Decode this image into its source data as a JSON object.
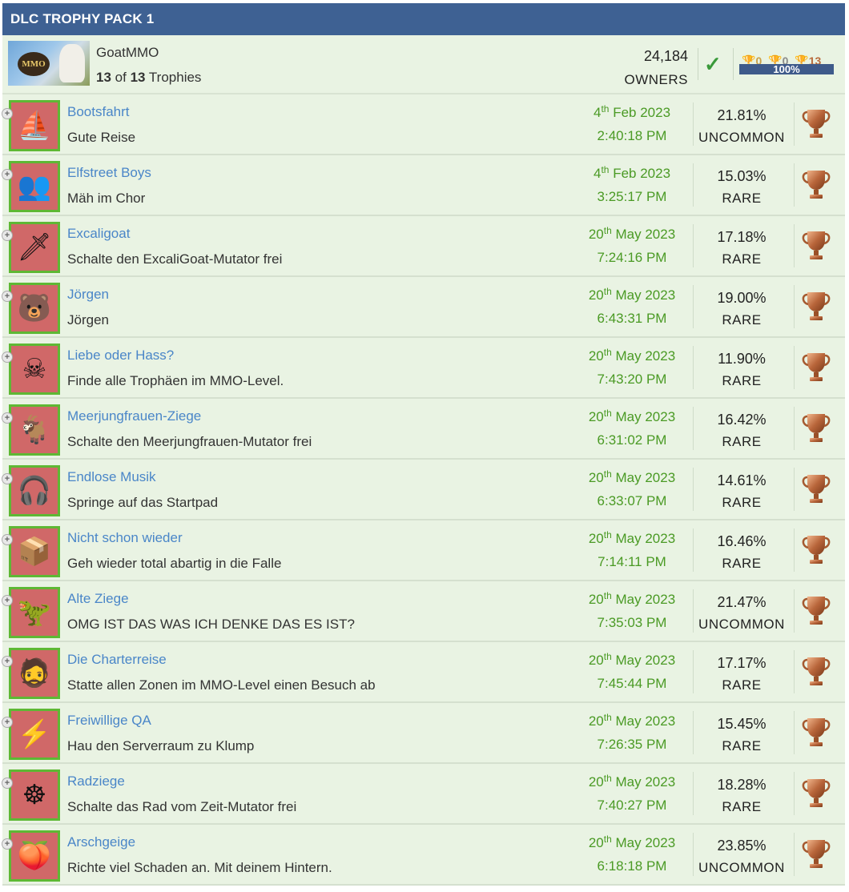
{
  "header": {
    "title": "DLC TROPHY PACK 1"
  },
  "game": {
    "name": "GoatMMO",
    "earned": "13",
    "of_label": "of",
    "total": "13",
    "trophies_label": "Trophies",
    "owners_count": "24,184",
    "owners_label": "OWNERS",
    "gold": "0",
    "silver": "0",
    "bronze": "13",
    "progress_label": "100%",
    "progress": 1.0,
    "thumb_logo": "MMO"
  },
  "colors": {
    "header_bg": "#3e6193",
    "row_bg": "#e9f3e3",
    "earned_border": "#5eb834",
    "name_link": "#4a86c8",
    "date_green": "#4a9a24",
    "bronze": "#b86a3c"
  },
  "trophies": [
    {
      "icon": "boat-icon",
      "glyph": "⛵",
      "name": "Bootsfahrt",
      "desc": "Gute Reise",
      "day": "4",
      "suffix": "th",
      "monthyear": "Feb 2023",
      "time": "2:40:18 PM",
      "pct": "21.81%",
      "rarity": "UNCOMMON"
    },
    {
      "icon": "band-icon",
      "glyph": "👥",
      "name": "Elfstreet Boys",
      "desc": "Mäh im Chor",
      "day": "4",
      "suffix": "th",
      "monthyear": "Feb 2023",
      "time": "3:25:17 PM",
      "pct": "15.03%",
      "rarity": "RARE"
    },
    {
      "icon": "sword-icon",
      "glyph": "🗡",
      "name": "Excaligoat",
      "desc": "Schalte den ExcaliGoat-Mutator frei",
      "day": "20",
      "suffix": "th",
      "monthyear": "May 2023",
      "time": "7:24:16 PM",
      "pct": "17.18%",
      "rarity": "RARE"
    },
    {
      "icon": "bear-icon",
      "glyph": "🐻",
      "name": "Jörgen",
      "desc": "Jörgen",
      "day": "20",
      "suffix": "th",
      "monthyear": "May 2023",
      "time": "6:43:31 PM",
      "pct": "19.00%",
      "rarity": "RARE"
    },
    {
      "icon": "skull-icon",
      "glyph": "☠",
      "name": "Liebe oder Hass?",
      "desc": "Finde alle Trophäen im MMO-Level.",
      "day": "20",
      "suffix": "th",
      "monthyear": "May 2023",
      "time": "7:43:20 PM",
      "pct": "11.90%",
      "rarity": "RARE"
    },
    {
      "icon": "mermaid-goat-icon",
      "glyph": "🐐",
      "name": "Meerjungfrauen-Ziege",
      "desc": "Schalte den Meerjungfrauen-Mutator frei",
      "day": "20",
      "suffix": "th",
      "monthyear": "May 2023",
      "time": "6:31:02 PM",
      "pct": "16.42%",
      "rarity": "RARE"
    },
    {
      "icon": "headphones-icon",
      "glyph": "🎧",
      "name": "Endlose Musik",
      "desc": "Springe auf das Startpad",
      "day": "20",
      "suffix": "th",
      "monthyear": "May 2023",
      "time": "6:33:07 PM",
      "pct": "14.61%",
      "rarity": "RARE"
    },
    {
      "icon": "box-icon",
      "glyph": "📦",
      "name": "Nicht schon wieder",
      "desc": "Geh wieder total abartig in die Falle",
      "day": "20",
      "suffix": "th",
      "monthyear": "May 2023",
      "time": "7:14:11 PM",
      "pct": "16.46%",
      "rarity": "RARE"
    },
    {
      "icon": "dinosaur-icon",
      "glyph": "🦖",
      "name": "Alte Ziege",
      "desc": "OMG IST DAS WAS ICH DENKE DAS ES IST?",
      "day": "20",
      "suffix": "th",
      "monthyear": "May 2023",
      "time": "7:35:03 PM",
      "pct": "21.47%",
      "rarity": "UNCOMMON"
    },
    {
      "icon": "bearded-man-icon",
      "glyph": "🧔",
      "name": "Die Charterreise",
      "desc": "Statte allen Zonen im MMO-Level einen Besuch ab",
      "day": "20",
      "suffix": "th",
      "monthyear": "May 2023",
      "time": "7:45:44 PM",
      "pct": "17.17%",
      "rarity": "RARE"
    },
    {
      "icon": "electric-shock-icon",
      "glyph": "⚡",
      "name": "Freiwillige QA",
      "desc": "Hau den Serverraum zu Klump",
      "day": "20",
      "suffix": "th",
      "monthyear": "May 2023",
      "time": "7:26:35 PM",
      "pct": "15.45%",
      "rarity": "RARE"
    },
    {
      "icon": "wheel-icon",
      "glyph": "☸",
      "name": "Radziege",
      "desc": "Schalte das Rad vom Zeit-Mutator frei",
      "day": "20",
      "suffix": "th",
      "monthyear": "May 2023",
      "time": "7:40:27 PM",
      "pct": "18.28%",
      "rarity": "RARE"
    },
    {
      "icon": "buttocks-icon",
      "glyph": "🍑",
      "name": "Arschgeige",
      "desc": "Richte viel Schaden an. Mit deinem Hintern.",
      "day": "20",
      "suffix": "th",
      "monthyear": "May 2023",
      "time": "6:18:18 PM",
      "pct": "23.85%",
      "rarity": "UNCOMMON"
    }
  ]
}
